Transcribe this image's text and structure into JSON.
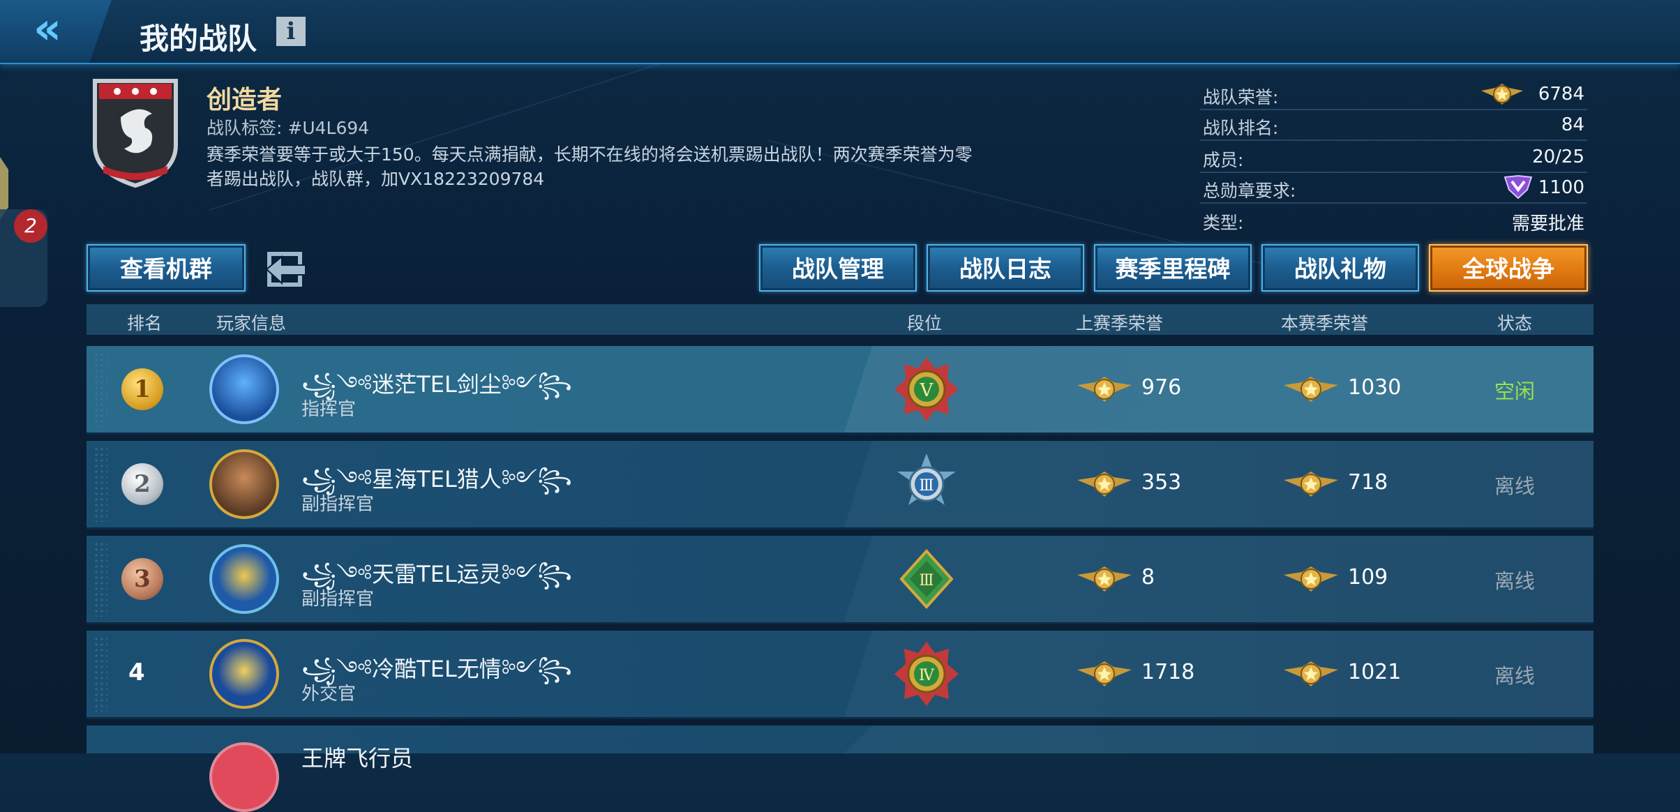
{
  "header": {
    "title": "我的战队",
    "info_icon": "i"
  },
  "side": {
    "badge": "2"
  },
  "team": {
    "name": "创造者",
    "tag": "战队标签: #U4L694",
    "description": "赛季荣誉要等于或大于150。每天点满捐献，长期不在线的将会送机票踢出战队！两次赛季荣誉为零者踢出战队，战队群，加VX18223209784"
  },
  "stats": [
    {
      "label": "战队荣誉:",
      "value": "6784",
      "icon": "honor-wing-icon"
    },
    {
      "label": "战队排名:",
      "value": "84"
    },
    {
      "label": "成员:",
      "value": "20/25"
    },
    {
      "label": "总勋章要求:",
      "value": "1100",
      "icon": "medal-icon"
    },
    {
      "label": "类型:",
      "value": "需要批准"
    }
  ],
  "buttons": {
    "view_fleet": "查看机群",
    "manage": "战队管理",
    "log": "战队日志",
    "milestone": "赛季里程碑",
    "gift": "战队礼物",
    "global_war": "全球战争"
  },
  "table": {
    "headers": {
      "rank": "排名",
      "player": "玩家信息",
      "tier": "段位",
      "last_season": "上赛季荣誉",
      "this_season": "本赛季荣誉",
      "status": "状态"
    },
    "rows": [
      {
        "rank": "1",
        "name": "꧁༺迷茫TEL剑尘༻꧂",
        "role": "指挥官",
        "tier": "V",
        "last": "976",
        "current": "1030",
        "status": "空闲"
      },
      {
        "rank": "2",
        "name": "꧁༺星海TEL猎人༻꧂",
        "role": "副指挥官",
        "tier": "Ⅲ",
        "last": "353",
        "current": "718",
        "status": "离线"
      },
      {
        "rank": "3",
        "name": "꧁༺天雷TEL运灵༻꧂",
        "role": "副指挥官",
        "tier": "Ⅲ",
        "last": "8",
        "current": "109",
        "status": "离线"
      },
      {
        "rank": "4",
        "name": "꧁༺冷酷TEL无情༻꧂",
        "role": "外交官",
        "tier": "Ⅳ",
        "last": "1718",
        "current": "1021",
        "status": "离线"
      },
      {
        "rank": "",
        "name": "王牌飞行员",
        "role": "",
        "tier": "",
        "last": "",
        "current": "",
        "status": ""
      }
    ]
  },
  "colors": {
    "accent": "#4fb3ee",
    "gold": "#d4a93c",
    "orange": "#e07a12",
    "online": "#9be04e"
  }
}
